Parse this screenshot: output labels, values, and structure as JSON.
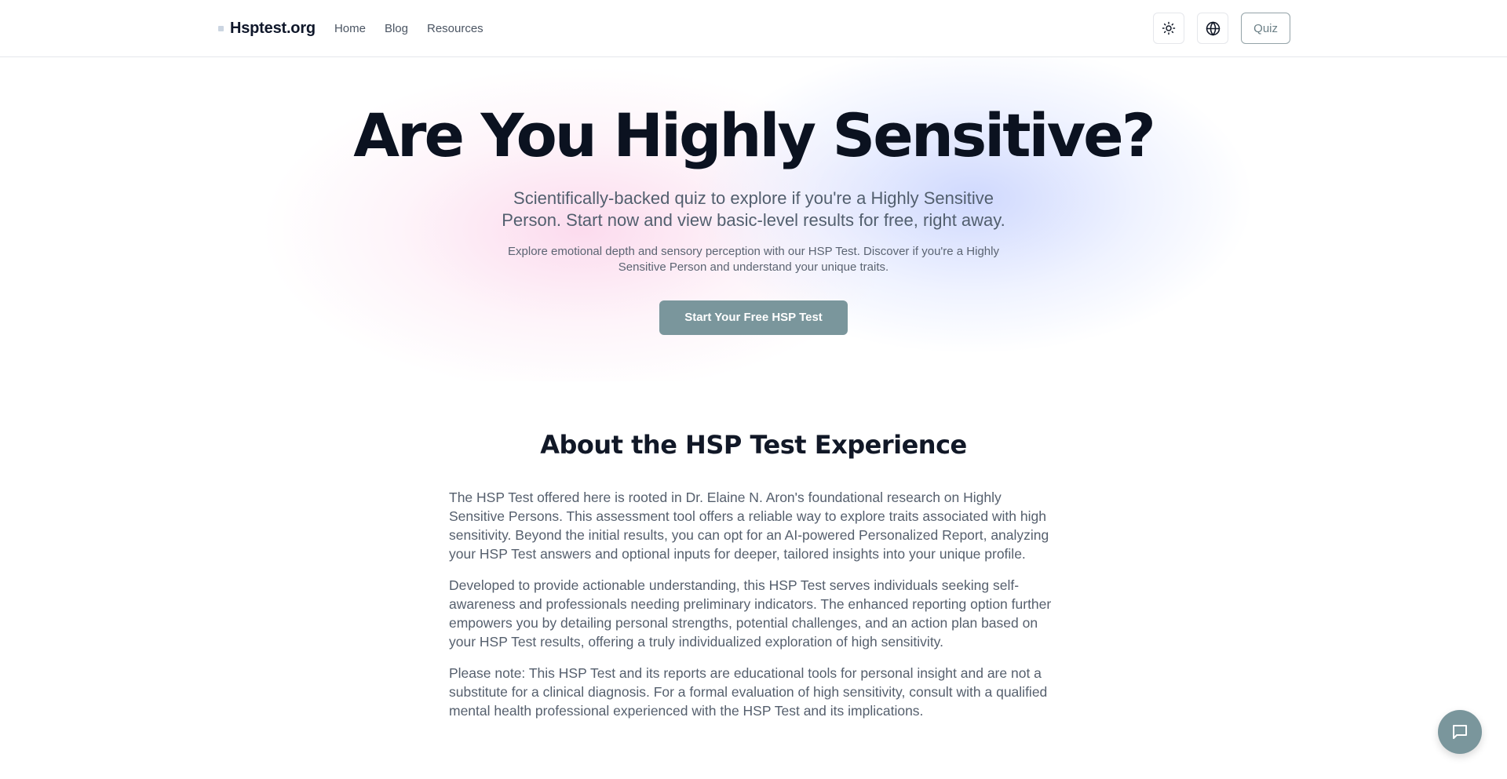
{
  "header": {
    "logo_text": "Hsptest.org",
    "nav": [
      {
        "label": "Home"
      },
      {
        "label": "Blog"
      },
      {
        "label": "Resources"
      }
    ],
    "theme_icon": "sun-icon",
    "language_icon": "globe-icon",
    "quiz_label": "Quiz"
  },
  "hero": {
    "title": "Are You Highly Sensitive?",
    "subtitle": "Scientifically-backed quiz to explore if you're a Highly Sensitive Person. Start now and view basic-level results for free, right away.",
    "description": "Explore emotional depth and sensory perception with our HSP Test. Discover if you're a Highly Sensitive Person and understand your unique traits.",
    "cta_label": "Start Your Free HSP Test"
  },
  "about": {
    "title": "About the HSP Test Experience",
    "paragraphs": [
      "The HSP Test offered here is rooted in Dr. Elaine N. Aron's foundational research on Highly Sensitive Persons. This assessment tool offers a reliable way to explore traits associated with high sensitivity. Beyond the initial results, you can opt for an AI-powered Personalized Report, analyzing your HSP Test answers and optional inputs for deeper, tailored insights into your unique profile.",
      "Developed to provide actionable understanding, this HSP Test serves individuals seeking self-awareness and professionals needing preliminary indicators. The enhanced reporting option further empowers you by detailing personal strengths, potential challenges, and an action plan based on your HSP Test results, offering a truly individualized exploration of high sensitivity.",
      "Please note: This HSP Test and its reports are educational tools for personal insight and are not a substitute for a clinical diagnosis. For a formal evaluation of high sensitivity, consult with a qualified mental health professional experienced with the HSP Test and its implications."
    ]
  },
  "chat": {
    "icon": "chat-bubble-icon"
  },
  "colors": {
    "accent": "#7a969c",
    "heading": "#0b1220",
    "body_text": "#555f6d"
  }
}
